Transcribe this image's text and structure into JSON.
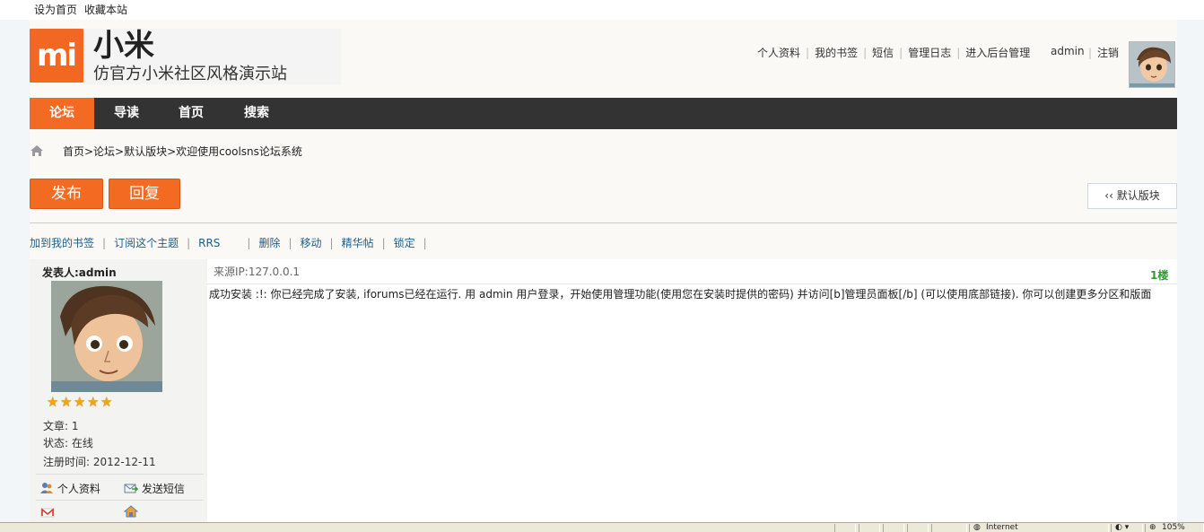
{
  "topbar": {
    "set_home": "设为首页",
    "bookmark_site": "收藏本站"
  },
  "logo": {
    "mark": "mi",
    "title": "小米",
    "subtitle": "仿官方小米社区风格演示站"
  },
  "usernav": {
    "profile": "个人资料",
    "my_bookmarks": "我的书签",
    "messages": "短信",
    "admin_log": "管理日志",
    "backend": "进入后台管理",
    "username": "admin",
    "logout": "注销"
  },
  "nav": {
    "tabs": [
      "论坛",
      "导读",
      "首页",
      "搜索"
    ],
    "active": 0
  },
  "breadcrumb": "首页>论坛>默认版块>欢迎使用coolsns论坛系统",
  "buttons": {
    "publish": "发布",
    "reply": "回复",
    "back": "‹‹ 默认版块"
  },
  "actions": [
    "加到我的书签",
    "订阅这个主题",
    "RRS",
    "删除",
    "移动",
    "精华帖",
    "锁定"
  ],
  "post": {
    "author_label": "发表人:admin",
    "rating": 5,
    "articles": "文章: 1",
    "status": "状态: 在线",
    "registered": "注册时间:  2012-12-11",
    "profile_link": "个人资料",
    "send_message": "发送短信",
    "ip": "来源IP:127.0.0.1",
    "floor": "1楼",
    "body": "成功安装 :!: 你已经完成了安装, iforums已经在运行. 用 admin 用户登录，开始使用管理功能(使用您在安装时提供的密码) 并访问[b]管理员面板[/b] (可以使用底部链接). 你可以创建更多分区和版面"
  },
  "statusbar": {
    "zone": "Internet",
    "zoom": "105%"
  },
  "colors": {
    "accent": "#f36b22",
    "nav_bg": "#333333",
    "link": "#1f5e86",
    "floor": "#2d9b2d"
  }
}
